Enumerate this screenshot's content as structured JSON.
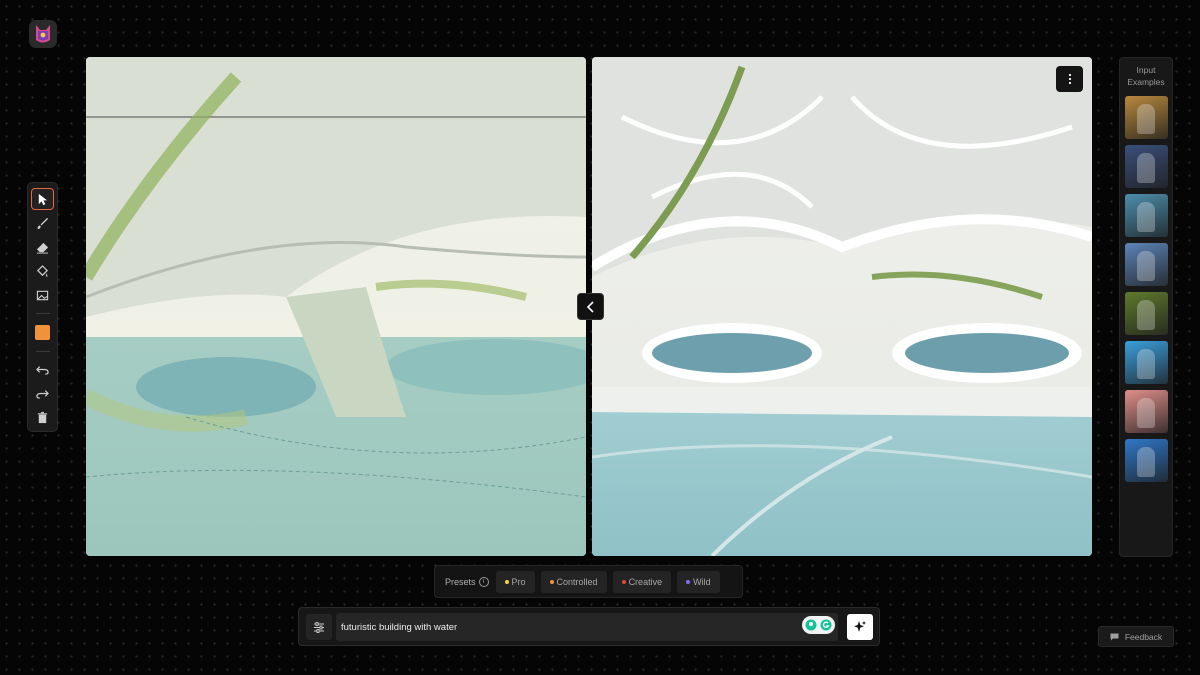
{
  "app": {
    "logo_icon": "fox-logo-icon"
  },
  "toolbar": {
    "tools": [
      {
        "id": "select",
        "icon": "cursor-icon",
        "active": true
      },
      {
        "id": "brush",
        "icon": "brush-icon",
        "active": false
      },
      {
        "id": "eraser",
        "icon": "eraser-icon",
        "active": false
      },
      {
        "id": "fill",
        "icon": "paint-bucket-icon",
        "active": false
      },
      {
        "id": "image",
        "icon": "image-icon",
        "active": false
      }
    ],
    "current_color": "#f0923a",
    "history": [
      "undo-icon",
      "redo-icon",
      "trash-icon"
    ]
  },
  "canvas": {
    "left_panel": "sketch-canvas",
    "right_panel": "generated-image",
    "menu_icon": "more-vertical-icon",
    "collapse_icon": "chevron-left-icon"
  },
  "examples": {
    "title_line1": "Input",
    "title_line2": "Examples",
    "thumbs": [
      {
        "name": "example-elf-archer",
        "color": "#b8893d"
      },
      {
        "name": "example-armored-knight",
        "color": "#3a4f7a"
      },
      {
        "name": "example-castle-scene",
        "color": "#4d8fae"
      },
      {
        "name": "example-forest-path",
        "color": "#5d84b8"
      },
      {
        "name": "example-tree-creature",
        "color": "#5f7a2e"
      },
      {
        "name": "example-octopus-silhouette",
        "color": "#3aa0de"
      },
      {
        "name": "example-elephant-drawing",
        "color": "#e08f8a"
      },
      {
        "name": "example-kids-drawing",
        "color": "#2f78c9"
      }
    ]
  },
  "presets": {
    "label": "Presets",
    "info_icon": "info-icon",
    "items": [
      {
        "label": "Pro",
        "dot": "#f0d24a"
      },
      {
        "label": "Controlled",
        "dot": "#f0923a"
      },
      {
        "label": "Creative",
        "dot": "#e8453c"
      },
      {
        "label": "Wild",
        "dot": "#8a6cf0"
      }
    ]
  },
  "prompt": {
    "value": "futuristic building with water",
    "settings_icon": "sliders-icon",
    "generate_icon": "sparkle-icon"
  },
  "feedback": {
    "label": "Feedback",
    "icon": "chat-icon"
  }
}
